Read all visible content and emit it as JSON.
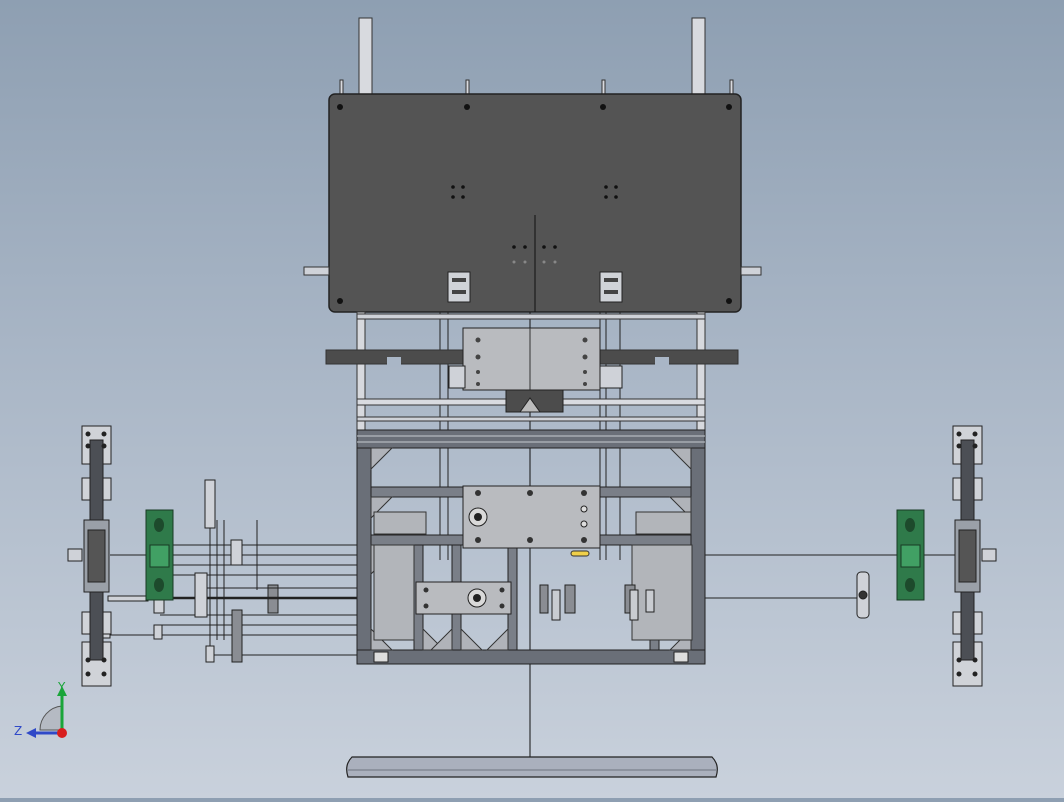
{
  "viewport": {
    "background_top": "#8e9fb2",
    "background_bottom": "#c9d1dc"
  },
  "triad": {
    "y_label": "Y",
    "z_label": "Z",
    "y_color": "#1aa53a",
    "z_color": "#2f49c8",
    "x_color": "#d81e1e"
  },
  "colors": {
    "plate": "#545454",
    "frame": "#6a6f78",
    "frame_light": "#b8bcc3",
    "bracket": "#8a8d93",
    "mount_green": "#2f7a4a",
    "base": "#aab0bd"
  }
}
